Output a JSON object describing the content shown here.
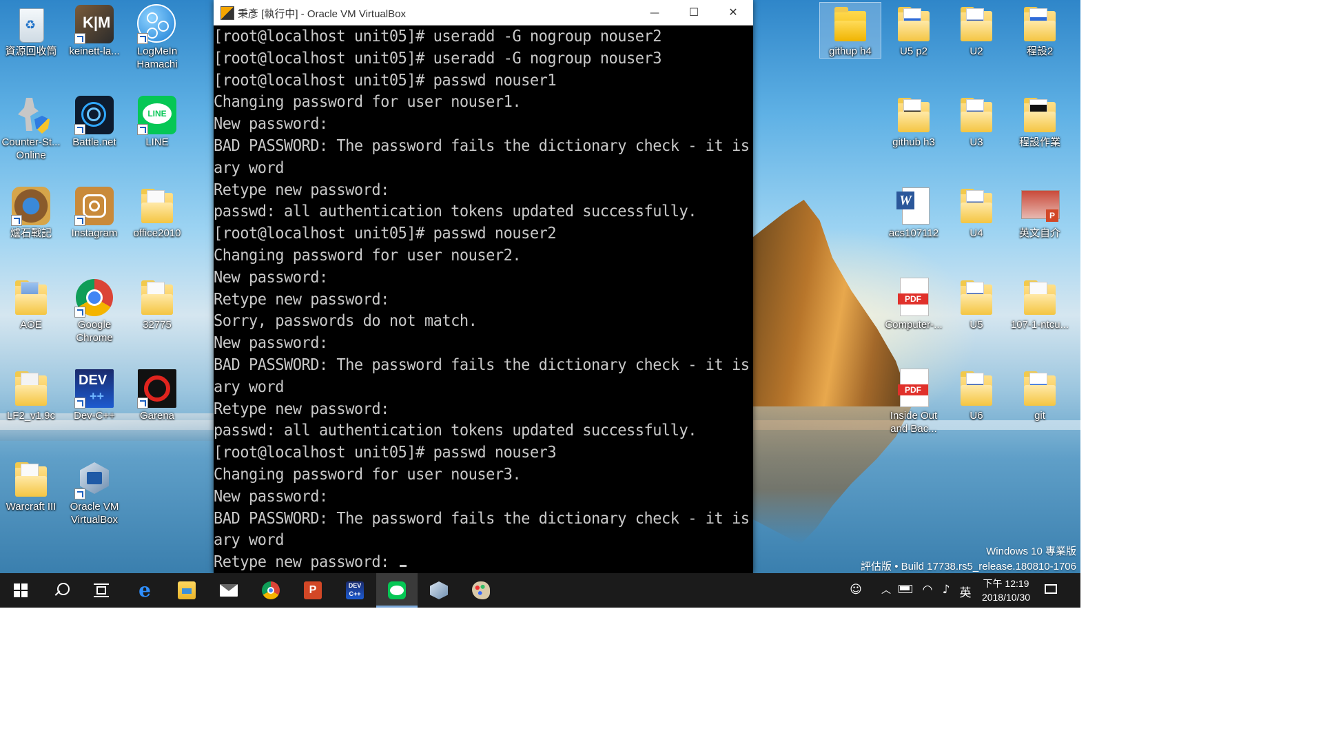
{
  "desktop": {
    "icons": [
      {
        "label": "資源回收筒"
      },
      {
        "label": "keinett-la..."
      },
      {
        "label": "LogMeIn\nHamachi"
      },
      {
        "label": "Counter-St...\nOnline"
      },
      {
        "label": "Battle.net"
      },
      {
        "label": "LINE"
      },
      {
        "label": "爐石戰記"
      },
      {
        "label": "Instagram"
      },
      {
        "label": "office2010"
      },
      {
        "label": "AOE"
      },
      {
        "label": "Google\nChrome"
      },
      {
        "label": "32775"
      },
      {
        "label": "LF2_v1.9c"
      },
      {
        "label": "Dev-C++"
      },
      {
        "label": "Garena"
      },
      {
        "label": "Warcraft III"
      },
      {
        "label": "Oracle VM\nVirtualBox"
      },
      {
        "label": "githup h4"
      },
      {
        "label": "U5 p2"
      },
      {
        "label": "U2"
      },
      {
        "label": "程設2"
      },
      {
        "label": "github h3"
      },
      {
        "label": "U3"
      },
      {
        "label": "程設作業"
      },
      {
        "label": "acs107112"
      },
      {
        "label": "U4"
      },
      {
        "label": "英文自介"
      },
      {
        "label": "Computer-..."
      },
      {
        "label": "U5"
      },
      {
        "label": "107-1-ntcu..."
      },
      {
        "label": "Inside Out\nand Bac..."
      },
      {
        "label": "U6"
      },
      {
        "label": "git"
      }
    ]
  },
  "window": {
    "title": "秉彥 [執行中] - Oracle VM VirtualBox",
    "controls": {
      "minimize": "—",
      "maximize": "☐",
      "close": "✕"
    }
  },
  "terminal": {
    "lines": [
      "[root@localhost unit05]# useradd -G nogroup nouser2",
      "[root@localhost unit05]# useradd -G nogroup nouser3",
      "[root@localhost unit05]# passwd nouser1",
      "Changing password for user nouser1.",
      "New password:",
      "BAD PASSWORD: The password fails the dictionary check - it is based on a diction",
      "ary word",
      "Retype new password:",
      "passwd: all authentication tokens updated successfully.",
      "[root@localhost unit05]# passwd nouser2",
      "Changing password for user nouser2.",
      "New password:",
      "Retype new password:",
      "Sorry, passwords do not match.",
      "New password:",
      "BAD PASSWORD: The password fails the dictionary check - it is based on a diction",
      "ary word",
      "Retype new password:",
      "passwd: all authentication tokens updated successfully.",
      "[root@localhost unit05]# passwd nouser3",
      "Changing password for user nouser3.",
      "New password:",
      "BAD PASSWORD: The password fails the dictionary check - it is based on a diction",
      "ary word",
      "Retype new password: "
    ]
  },
  "watermark": {
    "edition": "Windows 10 專業版",
    "build": "評估版 •  Build 17738.rs5_release.180810-1706"
  },
  "taskbar": {
    "apps": [
      "start",
      "search",
      "task-view",
      "edge",
      "file-explorer",
      "mail",
      "chrome",
      "powerpoint",
      "dev-cpp",
      "line",
      "virtualbox",
      "paint"
    ],
    "active_app": "line",
    "tray": {
      "input_method": "英",
      "time": "下午 12:19",
      "date": "2018/10/30"
    }
  },
  "colors": {
    "terminal_bg": "#000000",
    "terminal_fg": "#c8c8c8",
    "taskbar_bg": "#1b1b1b",
    "line_green": "#06c755"
  }
}
